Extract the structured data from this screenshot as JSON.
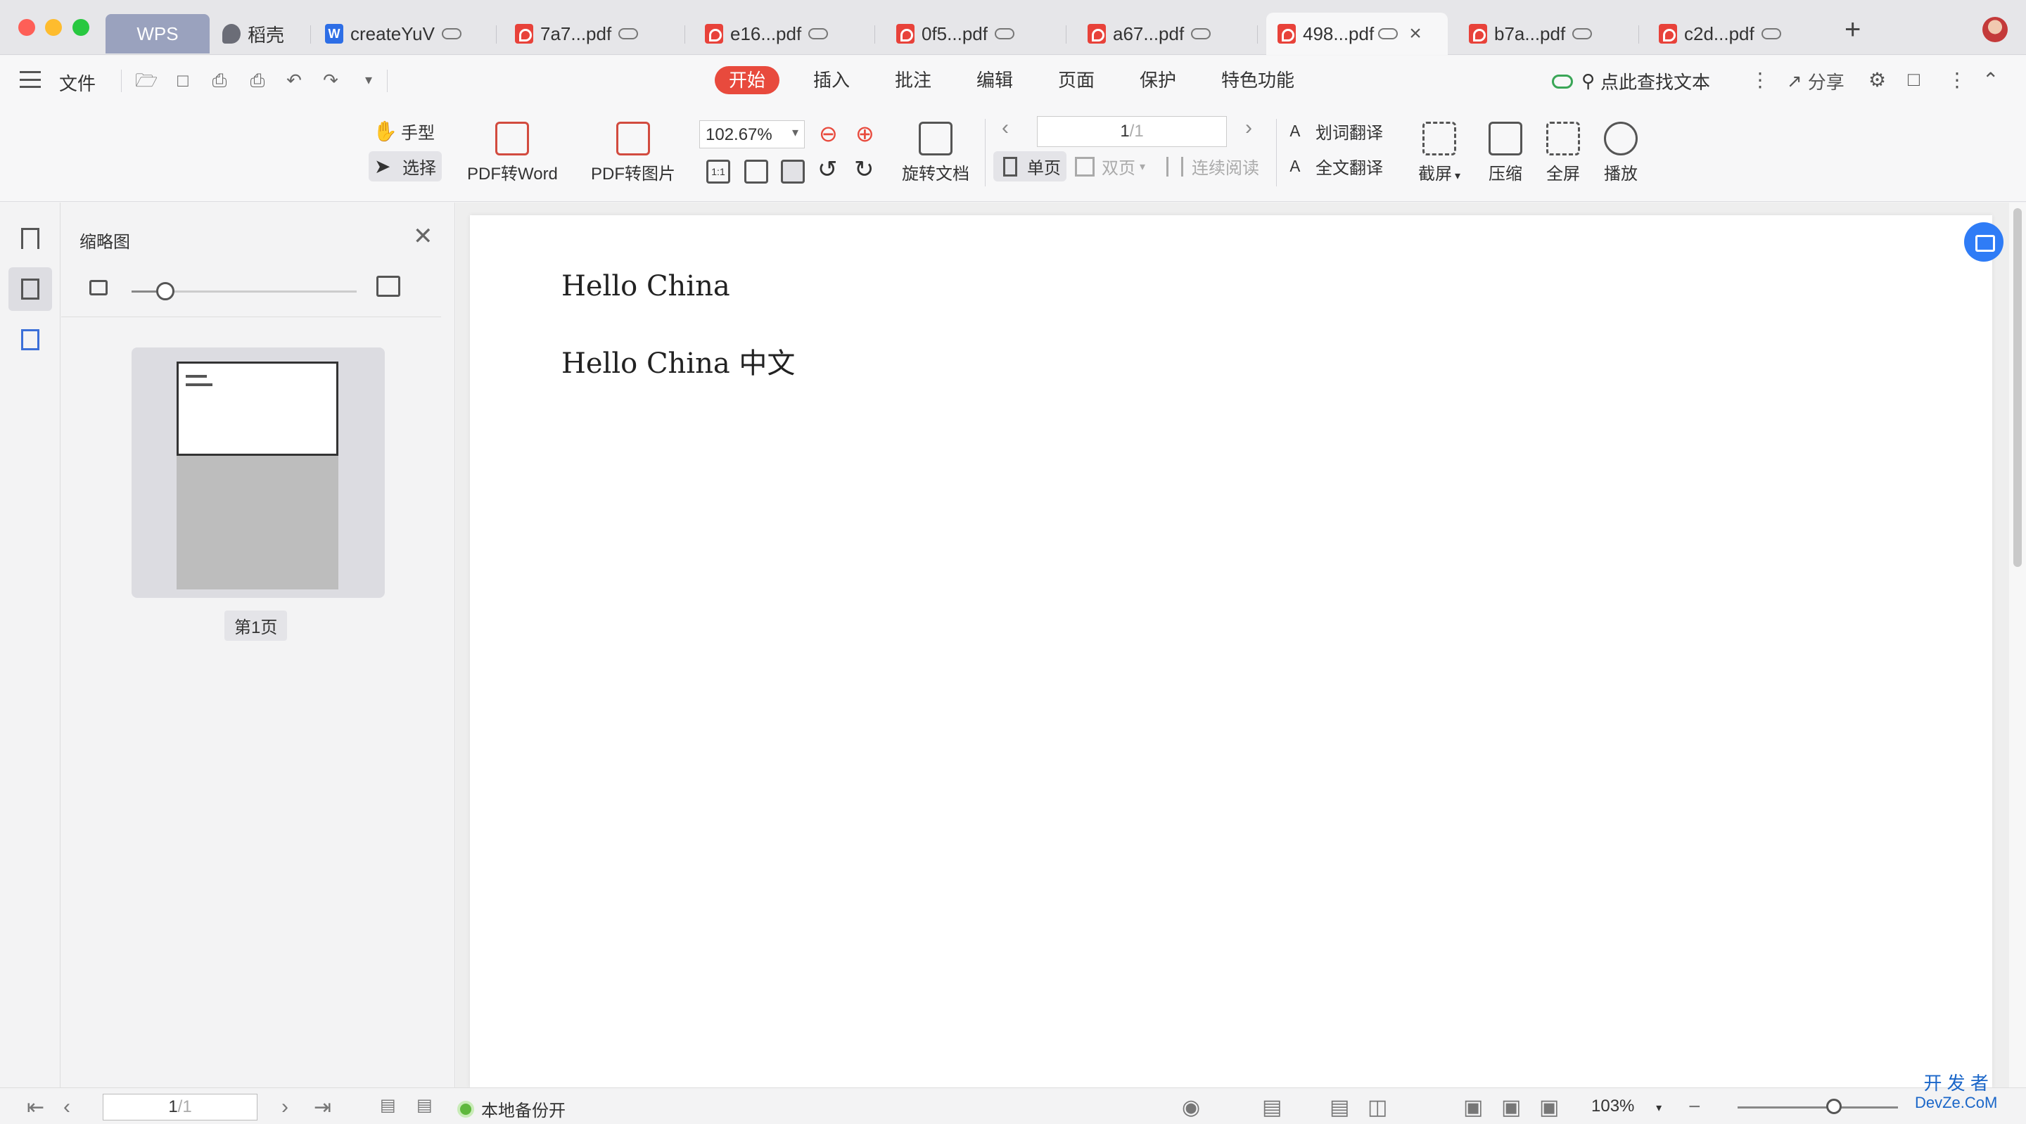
{
  "tabs": [
    {
      "label": "WPS",
      "type": "home"
    },
    {
      "label": "稻壳",
      "type": "shell"
    },
    {
      "label": "createYuV",
      "type": "doc"
    },
    {
      "label": "7a7...pdf",
      "type": "pdf"
    },
    {
      "label": "e16...pdf",
      "type": "pdf"
    },
    {
      "label": "0f5...pdf",
      "type": "pdf"
    },
    {
      "label": "a67...pdf",
      "type": "pdf"
    },
    {
      "label": "498...pdf",
      "type": "pdf",
      "active": true
    },
    {
      "label": "b7a...pdf",
      "type": "pdf"
    },
    {
      "label": "c2d...pdf",
      "type": "pdf"
    }
  ],
  "new_tab": "+",
  "menu": {
    "file": "文件",
    "ribbon_tabs": [
      "开始",
      "插入",
      "批注",
      "编辑",
      "页面",
      "保护",
      "特色功能"
    ],
    "active_ribbon_tab": "开始",
    "search_text": "点此查找文本",
    "share": "分享"
  },
  "ribbon": {
    "hand": "手型",
    "select": "选择",
    "pdf_to_word": "PDF转Word",
    "pdf_to_image": "PDF转图片",
    "zoom": "102.67%",
    "rotate_doc": "旋转文档",
    "page_current": "1",
    "page_total": "/1",
    "single_page": "单页",
    "double_page": "双页",
    "continuous": "连续阅读",
    "word_translate": "划词翻译",
    "full_translate": "全文翻译",
    "screenshot": "截屏",
    "compress": "压缩",
    "fullscreen": "全屏",
    "play": "播放",
    "actual_size_glyph": "1:1"
  },
  "thumbnails": {
    "title": "缩略图",
    "page_label": "第1页",
    "size_level": 0.15
  },
  "document": {
    "lines": [
      "Hello China",
      "Hello China 中文"
    ]
  },
  "statusbar": {
    "page_current": "1",
    "page_total": "/1",
    "backup": "本地备份开",
    "zoom": "103%",
    "zoom_level": 0.6
  },
  "watermark": {
    "line1": "开 发 者",
    "line2": "DevZe.CoM"
  },
  "colors": {
    "accent_red": "#e84a3d",
    "pdf_red": "#e8423a",
    "float_blue": "#2f7cf6",
    "backup_green": "#5fb83d"
  }
}
